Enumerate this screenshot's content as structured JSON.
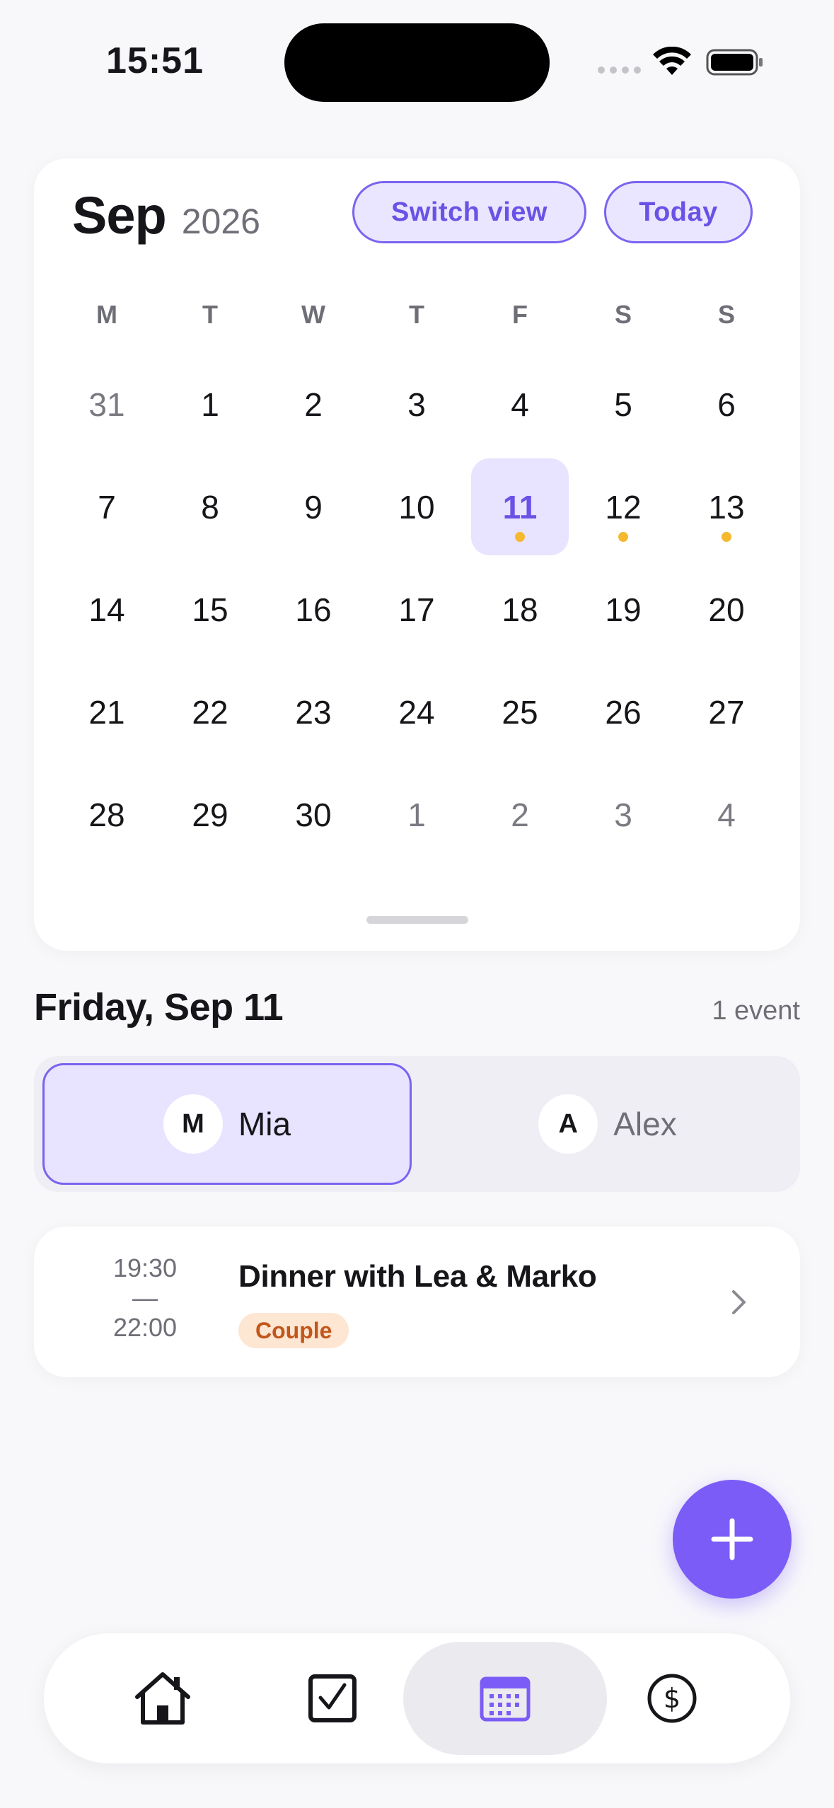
{
  "status_bar": {
    "time": "15:51"
  },
  "calendar": {
    "month": "Sep",
    "year": "2026",
    "switch_view_label": "Switch view",
    "today_label": "Today",
    "weekdays": [
      "M",
      "T",
      "W",
      "T",
      "F",
      "S",
      "S"
    ],
    "weeks": [
      [
        {
          "d": "31",
          "muted": true
        },
        {
          "d": "1"
        },
        {
          "d": "2"
        },
        {
          "d": "3"
        },
        {
          "d": "4"
        },
        {
          "d": "5"
        },
        {
          "d": "6"
        }
      ],
      [
        {
          "d": "7"
        },
        {
          "d": "8"
        },
        {
          "d": "9"
        },
        {
          "d": "10"
        },
        {
          "d": "11",
          "selected": true,
          "dot": true
        },
        {
          "d": "12",
          "dot": true
        },
        {
          "d": "13",
          "dot": true
        }
      ],
      [
        {
          "d": "14"
        },
        {
          "d": "15"
        },
        {
          "d": "16"
        },
        {
          "d": "17"
        },
        {
          "d": "18"
        },
        {
          "d": "19"
        },
        {
          "d": "20"
        }
      ],
      [
        {
          "d": "21"
        },
        {
          "d": "22"
        },
        {
          "d": "23"
        },
        {
          "d": "24"
        },
        {
          "d": "25"
        },
        {
          "d": "26"
        },
        {
          "d": "27"
        }
      ],
      [
        {
          "d": "28"
        },
        {
          "d": "29"
        },
        {
          "d": "30"
        },
        {
          "d": "1",
          "muted": true
        },
        {
          "d": "2",
          "muted": true
        },
        {
          "d": "3",
          "muted": true
        },
        {
          "d": "4",
          "muted": true
        }
      ]
    ]
  },
  "day_header": {
    "title": "Friday, Sep 11",
    "event_count": "1 event"
  },
  "people": [
    {
      "initial": "M",
      "name": "Mia",
      "active": true
    },
    {
      "initial": "A",
      "name": "Alex",
      "active": false
    }
  ],
  "event": {
    "start": "19:30",
    "separator": "—",
    "end": "22:00",
    "title": "Dinner with Lea & Marko",
    "tag": "Couple"
  },
  "tabs": [
    {
      "icon": "home-icon",
      "active": false
    },
    {
      "icon": "checkbox-icon",
      "active": false
    },
    {
      "icon": "calendar-icon",
      "active": true
    },
    {
      "icon": "dollar-icon",
      "active": false
    }
  ],
  "colors": {
    "accent": "#7b5cf6",
    "selected_bg": "#e8e3ff",
    "event_dot": "#f5b82e",
    "tag_bg": "#fde6d2",
    "tag_text": "#c2561b"
  }
}
